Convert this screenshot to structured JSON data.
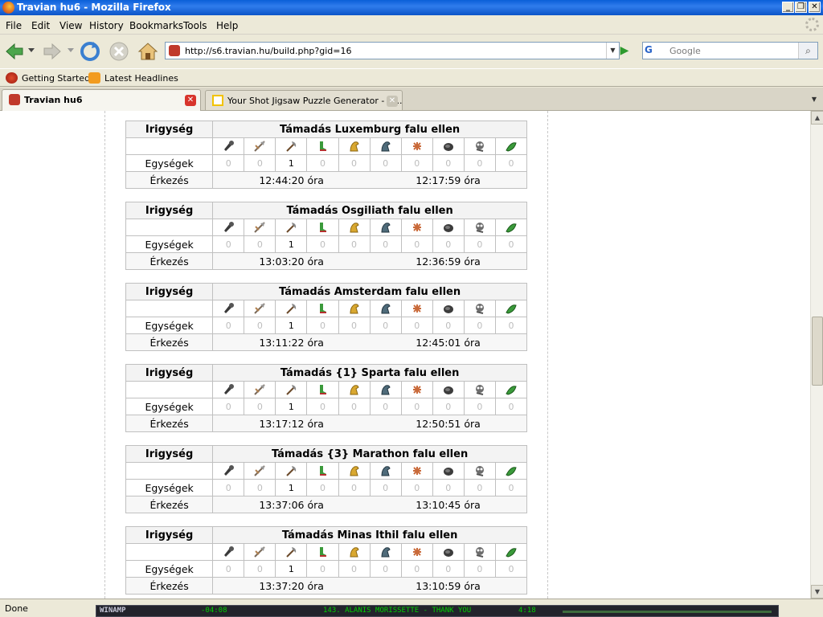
{
  "window": {
    "title": "Travian hu6 - Mozilla Firefox"
  },
  "menu": [
    "File",
    "Edit",
    "View",
    "History",
    "Bookmarks",
    "Tools",
    "Help"
  ],
  "address": {
    "url": "http://s6.travian.hu/build.php?gid=16"
  },
  "search": {
    "engine": "G",
    "placeholder": "Google"
  },
  "bookmarks": [
    {
      "label": "Getting Started",
      "icon": "firefox-icon"
    },
    {
      "label": "Latest Headlines",
      "icon": "rss-icon"
    }
  ],
  "tabs": [
    {
      "label": "Travian hu6",
      "active": true
    },
    {
      "label": "Your Shot Jigsaw Puzzle Generator - N...",
      "active": false
    }
  ],
  "table_labels": {
    "left_header": "Irigység",
    "units_label": "Egységek",
    "arrival_label": "Érkezés"
  },
  "unit_icons": [
    "club-icon",
    "spear-icon",
    "axe-icon",
    "scout-icon",
    "paladin-icon",
    "teutonic-knight-icon",
    "ram-icon",
    "catapult-icon",
    "chief-icon",
    "settler-icon"
  ],
  "attacks": [
    {
      "title": "Támadás Luxemburg falu ellen",
      "units": [
        0,
        0,
        1,
        0,
        0,
        0,
        0,
        0,
        0,
        0
      ],
      "arrival": "12:44:20 óra",
      "time2": "12:17:59 óra"
    },
    {
      "title": "Támadás Osgiliath falu ellen",
      "units": [
        0,
        0,
        1,
        0,
        0,
        0,
        0,
        0,
        0,
        0
      ],
      "arrival": "13:03:20 óra",
      "time2": "12:36:59 óra"
    },
    {
      "title": "Támadás Amsterdam falu ellen",
      "units": [
        0,
        0,
        1,
        0,
        0,
        0,
        0,
        0,
        0,
        0
      ],
      "arrival": "13:11:22 óra",
      "time2": "12:45:01 óra"
    },
    {
      "title": "Támadás {1} Sparta falu ellen",
      "units": [
        0,
        0,
        1,
        0,
        0,
        0,
        0,
        0,
        0,
        0
      ],
      "arrival": "13:17:12 óra",
      "time2": "12:50:51 óra"
    },
    {
      "title": "Támadás {3} Marathon falu ellen",
      "units": [
        0,
        0,
        1,
        0,
        0,
        0,
        0,
        0,
        0,
        0
      ],
      "arrival": "13:37:06 óra",
      "time2": "13:10:45 óra"
    },
    {
      "title": "Támadás Minas Ithil falu ellen",
      "units": [
        0,
        0,
        1,
        0,
        0,
        0,
        0,
        0,
        0,
        0
      ],
      "arrival": "13:37:20 óra",
      "time2": "13:10:59 óra"
    }
  ],
  "status": {
    "text": "Done"
  },
  "winamp": {
    "label": "WINAMP",
    "time": "-04:08",
    "track": "143. ALANIS MORISSETTE - THANK YOU",
    "duration": "4:18"
  }
}
